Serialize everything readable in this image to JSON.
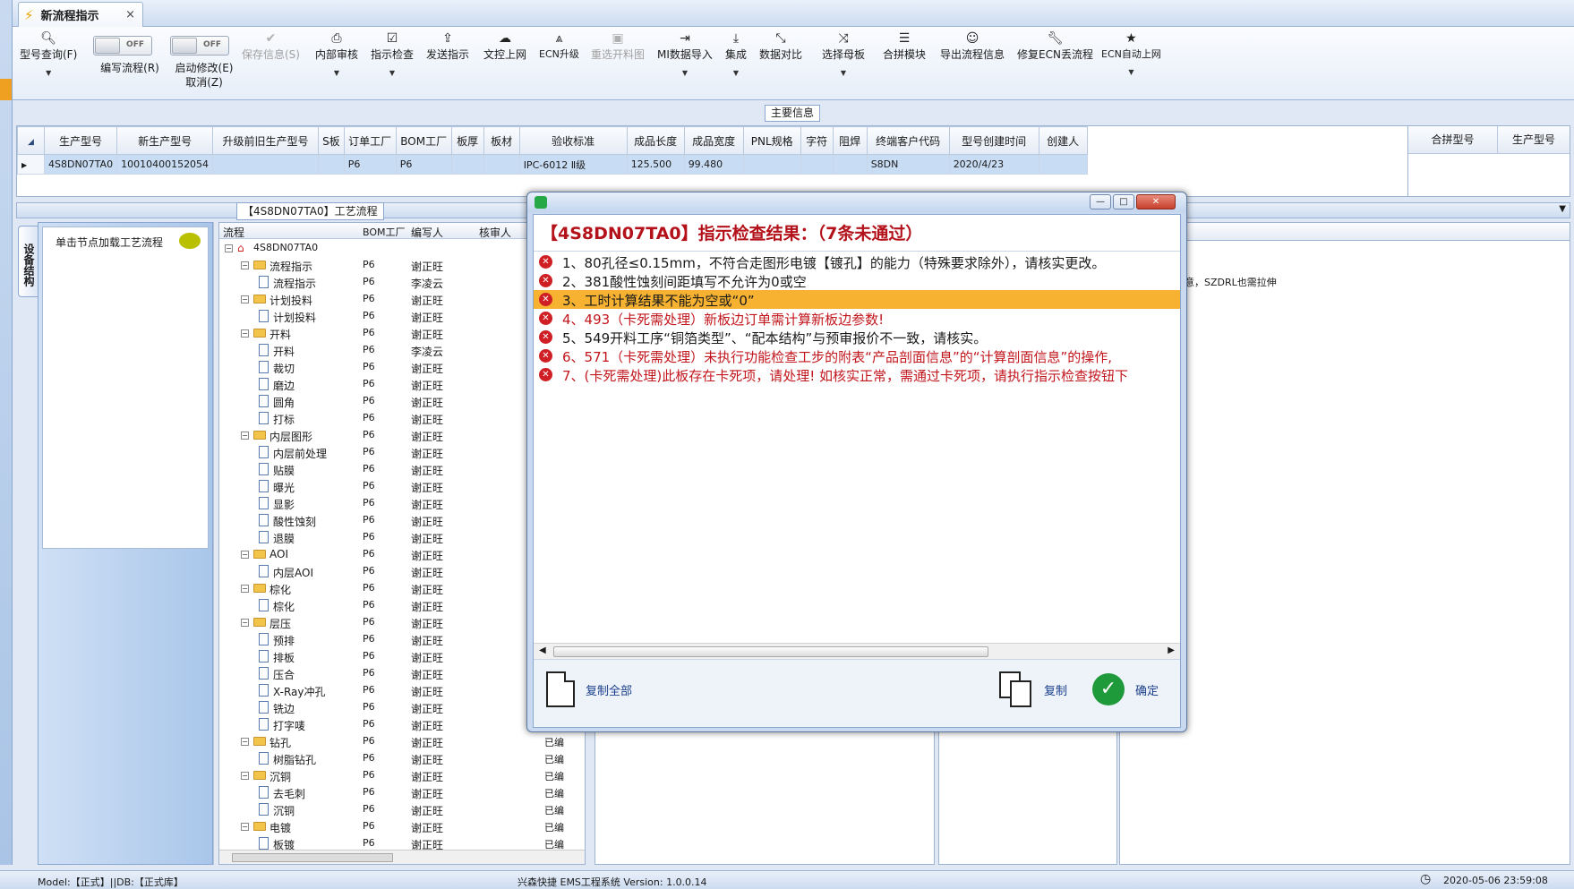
{
  "tab": {
    "title": "新流程指示",
    "close": "×"
  },
  "ribbon": {
    "query": "型号查询(F)",
    "edit_flow": "编写流程(R)",
    "auto_modify": "启动修改(E)",
    "cancel": "取消(Z)",
    "toggle_off": "OFF",
    "save": "保存信息(S)",
    "internal_review": "内部审核",
    "check": "指示检查",
    "send": "发送指示",
    "upload": "文控上网",
    "ecn": "ECN升级",
    "reselect": "重选开料图",
    "mi_import": "MI数据导入",
    "integrate": "集成",
    "compare": "数据对比",
    "select_board": "选择母板",
    "combine": "合拼模块",
    "export": "导出流程信息",
    "repair_ecn": "修复ECN丢流程",
    "ecn_auto": "ECN自动上网"
  },
  "main_info": {
    "title": "主要信息",
    "columns": [
      "生产型号",
      "新生产型号",
      "升级前旧生产型号",
      "S板",
      "订单工厂",
      "BOM工厂",
      "板厚",
      "板材",
      "验收标准",
      "成品长度",
      "成品宽度",
      "PNL规格",
      "字符",
      "阻焊",
      "终端客户代码",
      "型号创建时间",
      "创建人"
    ],
    "row": [
      "4S8DN07TA0",
      "10010400152054",
      "",
      "",
      "P6",
      "P6",
      "",
      "",
      "IPC-6012 Ⅱ级",
      "125.500",
      "99.480",
      "",
      "",
      "",
      "S8DN",
      "2020/4/23",
      ""
    ],
    "right_columns": [
      "合拼型号",
      "生产型号"
    ]
  },
  "flow_panel": {
    "title": "【4S8DN07TA0】工艺流程",
    "vertical_tab": "设备结构",
    "node_hint": "单击节点加载工艺流程",
    "headers": [
      "流程",
      "BOM工厂",
      "编写人",
      "核审人"
    ]
  },
  "tree": [
    {
      "label": "4S8DN07TA0",
      "lvl": 0,
      "type": "root",
      "factory": "",
      "writer": "",
      "status": ""
    },
    {
      "label": "流程指示",
      "lvl": 1,
      "type": "folder",
      "factory": "P6",
      "writer": "谢正旺",
      "status": ""
    },
    {
      "label": "流程指示",
      "lvl": 2,
      "type": "page",
      "factory": "P6",
      "writer": "李凌云",
      "status": ""
    },
    {
      "label": "计划投料",
      "lvl": 1,
      "type": "folder",
      "factory": "P6",
      "writer": "谢正旺",
      "status": ""
    },
    {
      "label": "计划投料",
      "lvl": 2,
      "type": "page",
      "factory": "P6",
      "writer": "谢正旺",
      "status": ""
    },
    {
      "label": "开料",
      "lvl": 1,
      "type": "folder",
      "factory": "P6",
      "writer": "谢正旺",
      "status": ""
    },
    {
      "label": "开料",
      "lvl": 2,
      "type": "page",
      "factory": "P6",
      "writer": "李凌云",
      "status": ""
    },
    {
      "label": "裁切",
      "lvl": 2,
      "type": "page",
      "factory": "P6",
      "writer": "谢正旺",
      "status": ""
    },
    {
      "label": "磨边",
      "lvl": 2,
      "type": "page",
      "factory": "P6",
      "writer": "谢正旺",
      "status": ""
    },
    {
      "label": "圆角",
      "lvl": 2,
      "type": "page",
      "factory": "P6",
      "writer": "谢正旺",
      "status": ""
    },
    {
      "label": "打标",
      "lvl": 2,
      "type": "page",
      "factory": "P6",
      "writer": "谢正旺",
      "status": ""
    },
    {
      "label": "内层图形",
      "lvl": 1,
      "type": "folder",
      "factory": "P6",
      "writer": "谢正旺",
      "status": ""
    },
    {
      "label": "内层前处理",
      "lvl": 2,
      "type": "page",
      "factory": "P6",
      "writer": "谢正旺",
      "status": ""
    },
    {
      "label": "贴膜",
      "lvl": 2,
      "type": "page",
      "factory": "P6",
      "writer": "谢正旺",
      "status": ""
    },
    {
      "label": "曝光",
      "lvl": 2,
      "type": "page",
      "factory": "P6",
      "writer": "谢正旺",
      "status": ""
    },
    {
      "label": "显影",
      "lvl": 2,
      "type": "page",
      "factory": "P6",
      "writer": "谢正旺",
      "status": ""
    },
    {
      "label": "酸性蚀刻",
      "lvl": 2,
      "type": "page",
      "factory": "P6",
      "writer": "谢正旺",
      "status": ""
    },
    {
      "label": "退膜",
      "lvl": 2,
      "type": "page",
      "factory": "P6",
      "writer": "谢正旺",
      "status": ""
    },
    {
      "label": "AOI",
      "lvl": 1,
      "type": "folder",
      "factory": "P6",
      "writer": "谢正旺",
      "status": ""
    },
    {
      "label": "内层AOI",
      "lvl": 2,
      "type": "page",
      "factory": "P6",
      "writer": "谢正旺",
      "status": ""
    },
    {
      "label": "棕化",
      "lvl": 1,
      "type": "folder",
      "factory": "P6",
      "writer": "谢正旺",
      "status": ""
    },
    {
      "label": "棕化",
      "lvl": 2,
      "type": "page",
      "factory": "P6",
      "writer": "谢正旺",
      "status": ""
    },
    {
      "label": "层压",
      "lvl": 1,
      "type": "folder",
      "factory": "P6",
      "writer": "谢正旺",
      "status": ""
    },
    {
      "label": "预排",
      "lvl": 2,
      "type": "page",
      "factory": "P6",
      "writer": "谢正旺",
      "status": ""
    },
    {
      "label": "排板",
      "lvl": 2,
      "type": "page",
      "factory": "P6",
      "writer": "谢正旺",
      "status": ""
    },
    {
      "label": "压合",
      "lvl": 2,
      "type": "page",
      "factory": "P6",
      "writer": "谢正旺",
      "status": ""
    },
    {
      "label": "X-Ray冲孔",
      "lvl": 2,
      "type": "page",
      "factory": "P6",
      "writer": "谢正旺",
      "status": ""
    },
    {
      "label": "铣边",
      "lvl": 2,
      "type": "page",
      "factory": "P6",
      "writer": "谢正旺",
      "status": ""
    },
    {
      "label": "打字唛",
      "lvl": 2,
      "type": "page",
      "factory": "P6",
      "writer": "谢正旺",
      "status": ""
    },
    {
      "label": "钻孔",
      "lvl": 1,
      "type": "folder",
      "factory": "P6",
      "writer": "谢正旺",
      "status": "已编"
    },
    {
      "label": "树脂钻孔",
      "lvl": 2,
      "type": "page",
      "factory": "P6",
      "writer": "谢正旺",
      "status": "已编"
    },
    {
      "label": "沉铜",
      "lvl": 1,
      "type": "folder",
      "factory": "P6",
      "writer": "谢正旺",
      "status": "已编"
    },
    {
      "label": "去毛刺",
      "lvl": 2,
      "type": "page",
      "factory": "P6",
      "writer": "谢正旺",
      "status": "已编"
    },
    {
      "label": "沉铜",
      "lvl": 2,
      "type": "page",
      "factory": "P6",
      "writer": "谢正旺",
      "status": "已编"
    },
    {
      "label": "电镀",
      "lvl": 1,
      "type": "folder",
      "factory": "P6",
      "writer": "谢正旺",
      "status": "已编"
    },
    {
      "label": "板镀",
      "lvl": 2,
      "type": "page",
      "factory": "P6",
      "writer": "谢正旺",
      "status": "已编"
    }
  ],
  "right_panel": {
    "note": "意，SZDRL也需拉伸"
  },
  "dialog": {
    "heading": "【4S8DN07TA0】指示检查结果：（7条未通过）",
    "minimize": "—",
    "maximize": "□",
    "close": "✕",
    "messages": [
      {
        "text": "1、80孔径≤0.15mm，不符合走图形电镀【镀孔】的能力（特殊要求除外），请核实更改。",
        "style": "normal"
      },
      {
        "text": "2、381酸性蚀刻间距填写不允许为0或空",
        "style": "normal"
      },
      {
        "text": "3、工时计算结果不能为空或“0”",
        "style": "selected"
      },
      {
        "text": "4、493（卡死需处理）新板边订单需计算新板边参数!",
        "style": "red"
      },
      {
        "text": "5、549开料工序“铜箔类型”、“配本结构”与预审报价不一致，请核实。",
        "style": "normal"
      },
      {
        "text": "6、571（卡死需处理）未执行功能检查工步的附表“产品剖面信息”的“计算剖面信息”的操作,",
        "style": "red"
      },
      {
        "text": "7、(卡死需处理)此板存在卡死项，请处理! 如核实正常，需通过卡死项，请执行指示检查按钮下",
        "style": "red"
      }
    ],
    "copy_all": "复制全部",
    "copy": "复制",
    "ok": "确定"
  },
  "status": {
    "left": "Model:【正式】||DB:【正式库】",
    "center": "兴森快捷  EMS工程系统  Version: 1.0.0.14",
    "time": "2020-05-06 23:59:08"
  }
}
